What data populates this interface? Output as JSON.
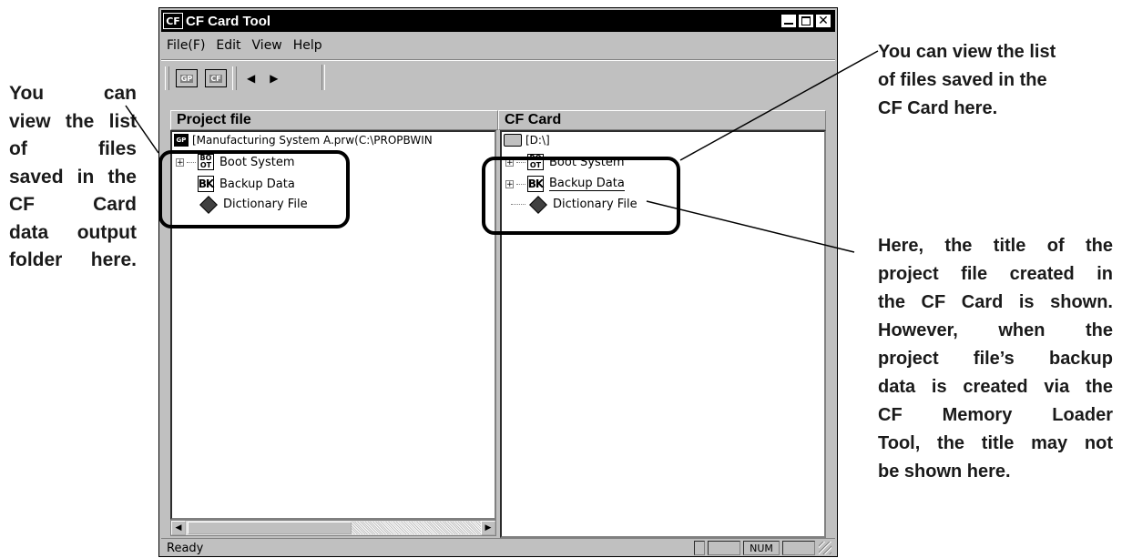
{
  "window": {
    "title": "CF Card Tool",
    "app_icon": "CF"
  },
  "menu": [
    "File(F)",
    "Edit",
    "View",
    "Help"
  ],
  "toolbar": {
    "icons": [
      "gp-icon",
      "cf-icon",
      "arrow-left-icon",
      "arrow-right-icon"
    ],
    "gp_label": "GP",
    "cf_label": "CF"
  },
  "panes": {
    "left": {
      "header": "Project file",
      "root": "[Manufacturing System A.prw(C:\\PROPBWIN",
      "items": [
        "Boot System",
        "Backup Data",
        "Dictionary File"
      ]
    },
    "right": {
      "header": "CF Card",
      "root": "[D:\\]",
      "items": [
        "Boot System",
        "Backup Data",
        "Dictionary File"
      ]
    }
  },
  "status": {
    "text": "Ready",
    "num": "NUM"
  },
  "annotations": {
    "left": [
      "You can",
      "view the list",
      "of files",
      "saved in the",
      "CF Card",
      "data output",
      "folder here."
    ],
    "right_top": [
      "You can view the list",
      "of files saved in the",
      "CF Card here."
    ],
    "right_bottom": [
      "Here, the title of the",
      "project file created in",
      "the CF Card is shown.",
      "However, when the",
      "project file’s backup",
      "data is created via the",
      "CF Memory Loader",
      "Tool, the title may not",
      "be shown here."
    ]
  }
}
